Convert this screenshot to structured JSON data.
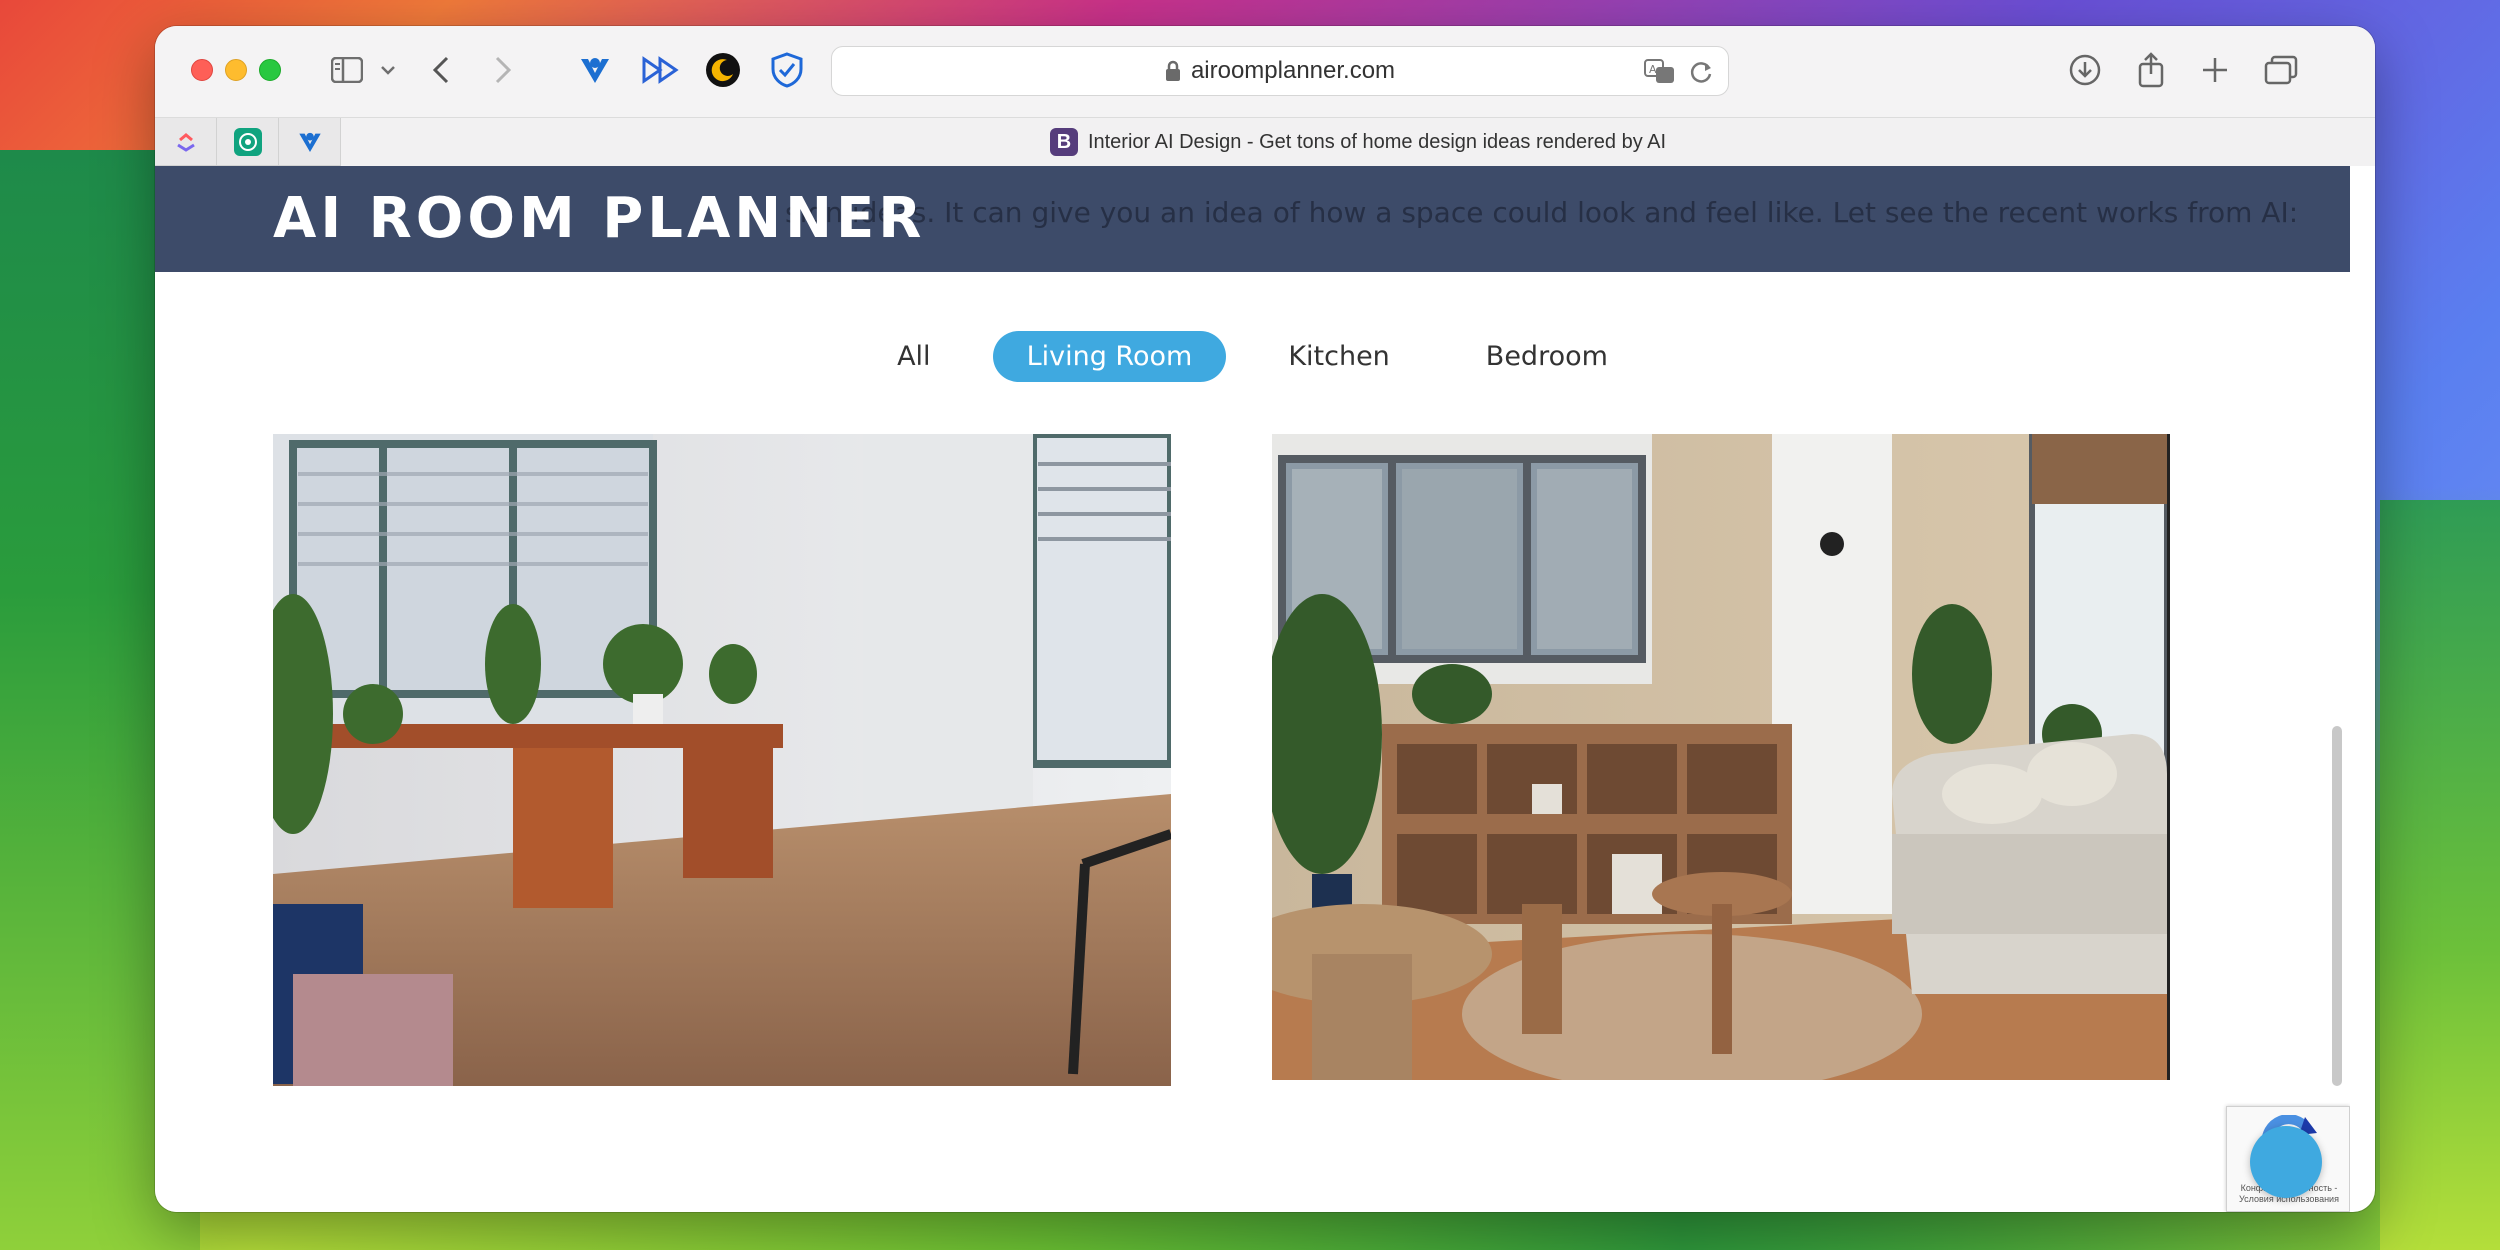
{
  "browser": {
    "url": "airoomplanner.com",
    "active_tab_title": "Interior AI Design - Get tons of home design ideas rendered by AI",
    "active_tab_favicon_letter": "B"
  },
  "page": {
    "logo": "AI ROOM PLANNER",
    "header_ghost_text": "sign ideas. It can give you an idea of how a space could look and feel like. Let see the recent works from AI:",
    "filters": [
      {
        "label": "All",
        "active": false
      },
      {
        "label": "Living Room",
        "active": true
      },
      {
        "label": "Kitchen",
        "active": false
      },
      {
        "label": "Bedroom",
        "active": false
      }
    ]
  },
  "recaptcha": {
    "text": "Конфиденциальность - Условия использования"
  },
  "colors": {
    "header_band": "#3d4b69",
    "active_filter": "#3fa9e0"
  }
}
